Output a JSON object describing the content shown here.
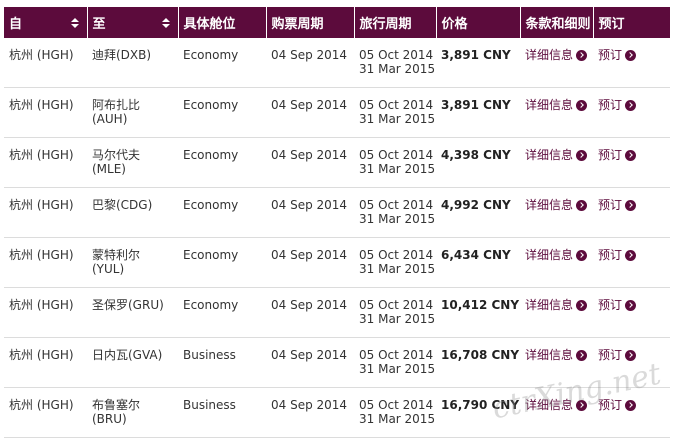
{
  "headers": [
    {
      "label": "自",
      "sortable": true
    },
    {
      "label": "至",
      "sortable": true
    },
    {
      "label": "具体舱位",
      "sortable": false
    },
    {
      "label": "购票周期",
      "sortable": false
    },
    {
      "label": "旅行周期",
      "sortable": false
    },
    {
      "label": "价格",
      "sortable": false
    },
    {
      "label": "条款和细则",
      "sortable": false
    },
    {
      "label": "预订",
      "sortable": false
    }
  ],
  "rows": [
    {
      "from": "杭州 (HGH)",
      "to_line1": "迪拜(DXB)",
      "to_line2": "",
      "cabin": "Economy",
      "purchase": "04 Sep 2014",
      "travel_start": "05 Oct 2014",
      "travel_end": "31 Mar 2015",
      "price": "3,891 CNY",
      "terms": "详细信息",
      "book": "预订"
    },
    {
      "from": "杭州 (HGH)",
      "to_line1": "阿布扎比",
      "to_line2": "(AUH)",
      "cabin": "Economy",
      "purchase": "04 Sep 2014",
      "travel_start": "05 Oct 2014",
      "travel_end": "31 Mar 2015",
      "price": "3,891 CNY",
      "terms": "详细信息",
      "book": "预订"
    },
    {
      "from": "杭州 (HGH)",
      "to_line1": "马尔代夫",
      "to_line2": "(MLE)",
      "cabin": "Economy",
      "purchase": "04 Sep 2014",
      "travel_start": "05 Oct 2014",
      "travel_end": "31 Mar 2015",
      "price": "4,398 CNY",
      "terms": "详细信息",
      "book": "预订"
    },
    {
      "from": "杭州 (HGH)",
      "to_line1": "巴黎(CDG)",
      "to_line2": "",
      "cabin": "Economy",
      "purchase": "04 Sep 2014",
      "travel_start": "05 Oct 2014",
      "travel_end": "31 Mar 2015",
      "price": "4,992 CNY",
      "terms": "详细信息",
      "book": "预订"
    },
    {
      "from": "杭州 (HGH)",
      "to_line1": "蒙特利尔",
      "to_line2": "(YUL)",
      "cabin": "Economy",
      "purchase": "04 Sep 2014",
      "travel_start": "05 Oct 2014",
      "travel_end": "31 Mar 2015",
      "price": "6,434 CNY",
      "terms": "详细信息",
      "book": "预订"
    },
    {
      "from": "杭州 (HGH)",
      "to_line1": "圣保罗(GRU)",
      "to_line2": "",
      "cabin": "Economy",
      "purchase": "04 Sep 2014",
      "travel_start": "05 Oct 2014",
      "travel_end": "31 Mar 2015",
      "price": "10,412 CNY",
      "terms": "详细信息",
      "book": "预订"
    },
    {
      "from": "杭州 (HGH)",
      "to_line1": "日内瓦(GVA)",
      "to_line2": "",
      "cabin": "Business",
      "purchase": "04 Sep 2014",
      "travel_start": "05 Oct 2014",
      "travel_end": "31 Mar 2015",
      "price": "16,708 CNY",
      "terms": "详细信息",
      "book": "预订"
    },
    {
      "from": "杭州 (HGH)",
      "to_line1": "布鲁塞尔",
      "to_line2": "(BRU)",
      "cabin": "Business",
      "purchase": "04 Sep 2014",
      "travel_start": "05 Oct 2014",
      "travel_end": "31 Mar 2015",
      "price": "16,790 CNY",
      "terms": "详细信息",
      "book": "预订"
    }
  ],
  "icons": {
    "sort": "sort-arrows-icon",
    "chevron": "chevron-right-circle-icon"
  },
  "colors": {
    "header_bg": "#5c0b3c",
    "link": "#5c0b3c"
  },
  "watermark": "ctrXing.net"
}
